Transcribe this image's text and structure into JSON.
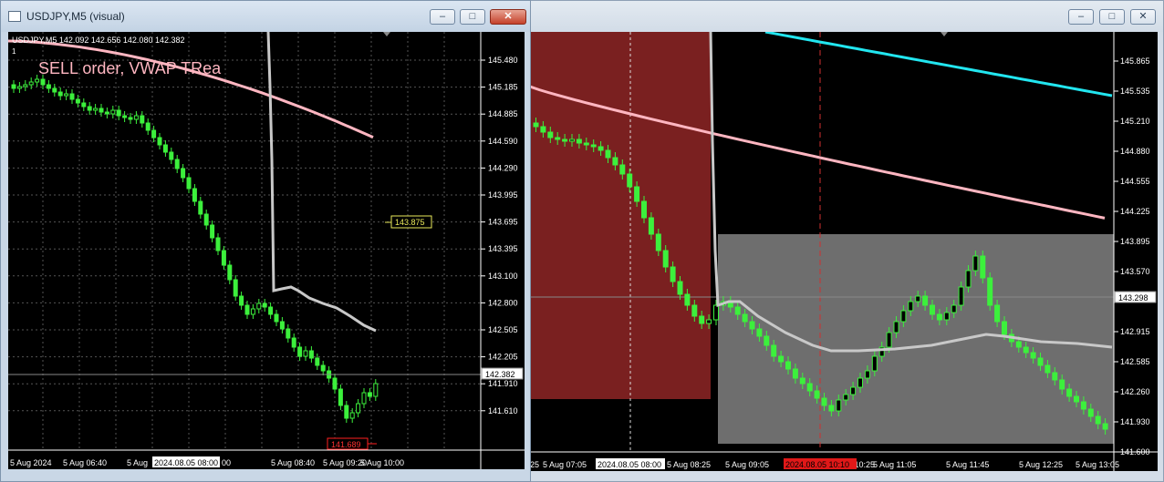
{
  "left_window": {
    "title": "USDJPY,M5 (visual)",
    "chart_info": "USDJPY,M5  142.092 142.656 142.080 142.382",
    "window_index": "1",
    "overlay_text": "SELL order, VWAP TRea",
    "price_axis": [
      "145.480",
      "145.185",
      "144.885",
      "144.590",
      "144.290",
      "143.995",
      "143.695",
      "143.395",
      "143.100",
      "142.800",
      "142.505",
      "142.205",
      "141.910",
      "141.610"
    ],
    "current_price": "142.382",
    "level_price": "143.875",
    "low_price": "141.689",
    "time_axis": [
      "5 Aug 2024",
      "5 Aug 06:40",
      "5 Aug",
      "5 Aug 08:40",
      "5 Aug 09:20",
      "5 Aug 10:00"
    ],
    "time_highlight": "2024.08.05 08:00",
    "time_tail": "00",
    "controls": {
      "minimize": "–",
      "maximize": "□",
      "close": "✕"
    }
  },
  "right_window": {
    "price_axis": [
      "145.865",
      "145.535",
      "145.210",
      "144.880",
      "144.555",
      "144.225",
      "143.895",
      "143.570",
      "142.915",
      "142.585",
      "142.260",
      "141.930",
      "141.600"
    ],
    "current_price": "143.298",
    "time_axis": [
      "25",
      "5 Aug 07:05",
      "5 Aug 08:25",
      "5 Aug 09:05",
      "5 Aug 10:25",
      "5 Aug 11:05",
      "5 Aug 11:45",
      "5 Aug 12:25",
      "5 Aug 13:05"
    ],
    "time_highlight": "2024.08.05 08:00",
    "time_highlight_red": "2024.08.05 10:10",
    "controls": {
      "minimize": "–",
      "maximize": "□",
      "close": "✕"
    }
  },
  "colors": {
    "candle_up": "#3cf03c",
    "vwap": "#ffb6c1",
    "gray_line": "#c8c8c8",
    "cyan_line": "#22e6f0",
    "red_zone": "#7a2020",
    "gray_zone": "#6e6e6e",
    "level_box": "#e8e85a",
    "low_box": "#ff2020"
  }
}
